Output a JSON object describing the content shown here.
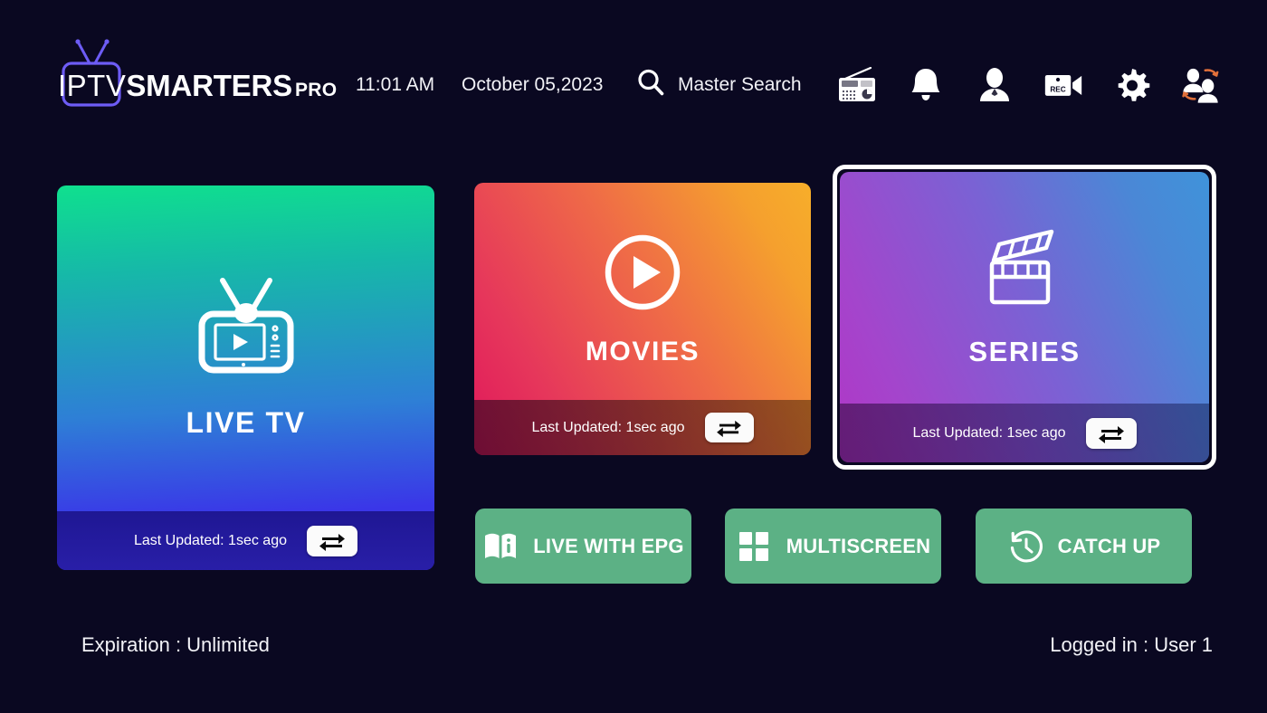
{
  "app": {
    "background_color": "#0a0821",
    "logo": {
      "part1": "IPTV",
      "part2": "SMARTERS",
      "part3": "PRO",
      "icon": "tv-antenna-icon"
    }
  },
  "header": {
    "time": "11:01 AM",
    "date": "October 05,2023",
    "search": {
      "icon": "search-icon",
      "label": "Master Search"
    },
    "icons": [
      {
        "name": "radio-icon",
        "title": "Radio"
      },
      {
        "name": "bell-icon",
        "title": "Notifications"
      },
      {
        "name": "account-icon",
        "title": "Account"
      },
      {
        "name": "rec-camera-icon",
        "title": "Recordings"
      },
      {
        "name": "gear-icon",
        "title": "Settings"
      },
      {
        "name": "switch-user-icon",
        "title": "Switch User"
      }
    ]
  },
  "cards": [
    {
      "id": "livetv",
      "title": "LIVE TV",
      "icon": "tv-play-icon",
      "updated_label": "Last Updated: 1sec ago",
      "refresh_icon": "refresh-loop-icon",
      "gradient_from": "#0fe08e",
      "gradient_to": "#3a36e8",
      "focused": false
    },
    {
      "id": "movies",
      "title": "MOVIES",
      "icon": "play-circle-icon",
      "updated_label": "Last Updated: 1sec ago",
      "refresh_icon": "refresh-loop-icon",
      "gradient_from": "#e0175b",
      "gradient_to": "#f7ae2a",
      "focused": false
    },
    {
      "id": "series",
      "title": "SERIES",
      "icon": "clapperboard-icon",
      "updated_label": "Last Updated: 1sec ago",
      "refresh_icon": "refresh-loop-icon",
      "gradient_from": "#b036c6",
      "gradient_to": "#3f93da",
      "focused": true
    }
  ],
  "quick_buttons": {
    "color": "#5cb185",
    "items": [
      {
        "id": "epg",
        "label": "LIVE WITH EPG",
        "icon": "book-info-icon"
      },
      {
        "id": "multiscreen",
        "label": "MULTISCREEN",
        "icon": "grid-four-icon"
      },
      {
        "id": "catchup",
        "label": "CATCH UP",
        "icon": "clock-rewind-icon"
      }
    ]
  },
  "footer": {
    "expiration": "Expiration : Unlimited",
    "logged_in": "Logged in : User 1"
  }
}
